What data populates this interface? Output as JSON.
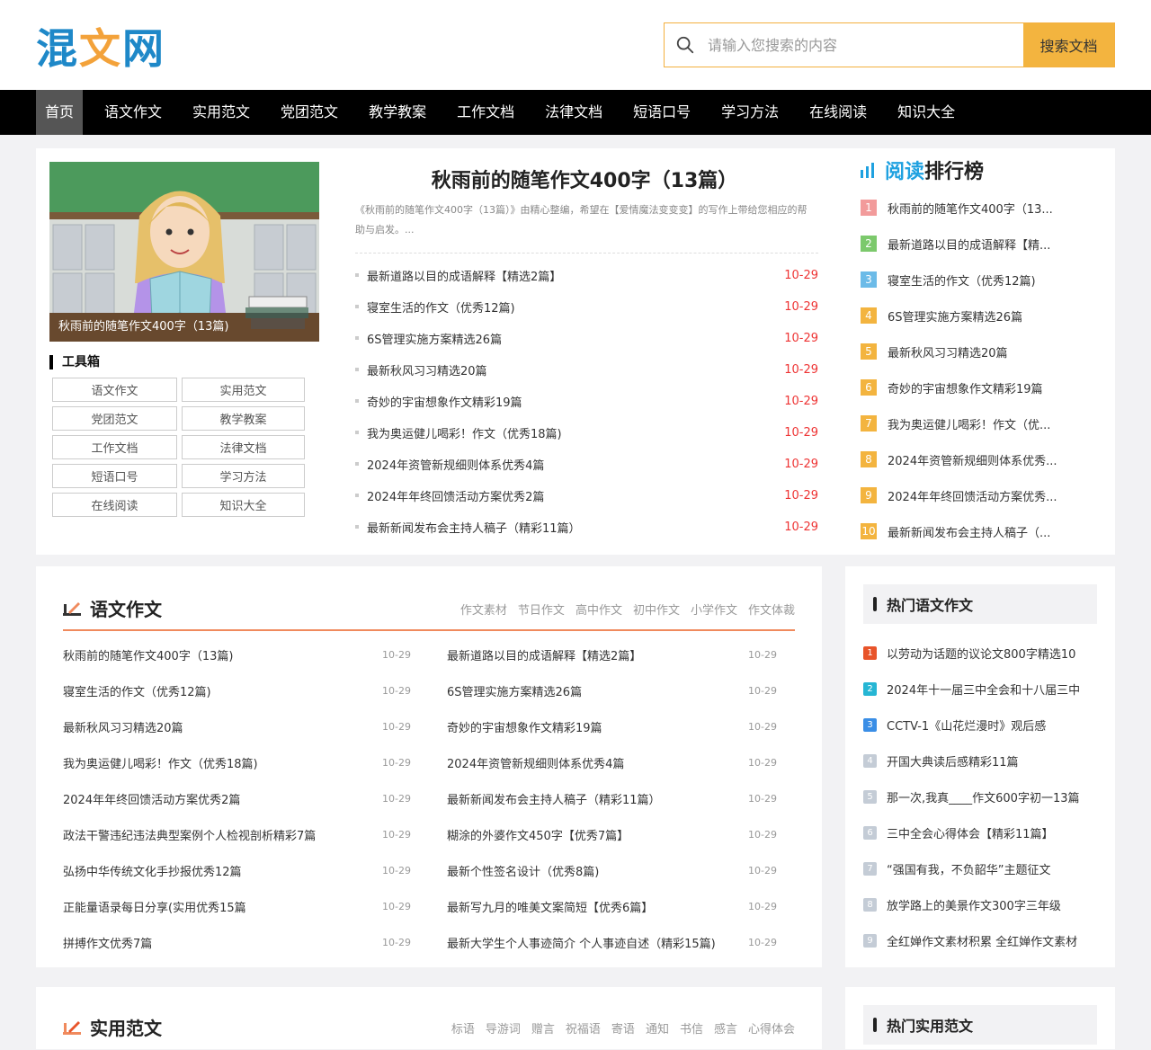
{
  "header": {
    "logo": [
      "混",
      "文",
      "网"
    ],
    "search": {
      "placeholder": "请输入您搜索的内容",
      "button": "搜索文档"
    }
  },
  "nav": [
    "首页",
    "语文作文",
    "实用范文",
    "党团范文",
    "教学教案",
    "工作文档",
    "法律文档",
    "短语口号",
    "学习方法",
    "在线阅读",
    "知识大全"
  ],
  "banner": {
    "caption": "秋雨前的随笔作文400字（13篇)"
  },
  "toolbox": {
    "title": "工具箱",
    "items": [
      "语文作文",
      "实用范文",
      "党团范文",
      "教学教案",
      "工作文档",
      "法律文档",
      "短语口号",
      "学习方法",
      "在线阅读",
      "知识大全"
    ]
  },
  "feature": {
    "title": "秋雨前的随笔作文400字（13篇）",
    "desc": "《秋雨前的随笔作文400字（13篇）》由精心整编，希望在【爱情魔法变变变】的写作上带给您相应的帮助与启发。...",
    "items": [
      {
        "title": "最新道路以目的成语解释【精选2篇】",
        "date": "10-29"
      },
      {
        "title": "寝室生活的作文（优秀12篇)",
        "date": "10-29"
      },
      {
        "title": "6S管理实施方案精选26篇",
        "date": "10-29"
      },
      {
        "title": "最新秋风习习精选20篇",
        "date": "10-29"
      },
      {
        "title": "奇妙的宇宙想象作文精彩19篇",
        "date": "10-29"
      },
      {
        "title": "我为奥运健儿喝彩！作文（优秀18篇)",
        "date": "10-29"
      },
      {
        "title": "2024年资管新规细则体系优秀4篇",
        "date": "10-29"
      },
      {
        "title": "2024年年终回馈活动方案优秀2篇",
        "date": "10-29"
      },
      {
        "title": "最新新闻发布会主持人稿子（精彩11篇）",
        "date": "10-29"
      }
    ]
  },
  "rank": {
    "title_hl": "阅读",
    "title_rest": "排行榜",
    "items": [
      {
        "num": "1",
        "title": "秋雨前的随笔作文400字（13...",
        "color": "#f29b9b"
      },
      {
        "num": "2",
        "title": "最新道路以目的成语解释【精...",
        "color": "#7cc96c"
      },
      {
        "num": "3",
        "title": "寝室生活的作文（优秀12篇)",
        "color": "#6cbbe8"
      },
      {
        "num": "4",
        "title": "6S管理实施方案精选26篇",
        "color": "#f3b43f"
      },
      {
        "num": "5",
        "title": "最新秋风习习精选20篇",
        "color": "#f3b43f"
      },
      {
        "num": "6",
        "title": "奇妙的宇宙想象作文精彩19篇",
        "color": "#f3b43f"
      },
      {
        "num": "7",
        "title": "我为奥运健儿喝彩！作文（优...",
        "color": "#f3b43f"
      },
      {
        "num": "8",
        "title": "2024年资管新规细则体系优秀...",
        "color": "#f3b43f"
      },
      {
        "num": "9",
        "title": "2024年年终回馈活动方案优秀...",
        "color": "#f3b43f"
      },
      {
        "num": "10",
        "title": "最新新闻发布会主持人稿子（...",
        "color": "#f3b43f"
      }
    ]
  },
  "yuwen": {
    "title": "语文作文",
    "tags": [
      "作文素材",
      "节日作文",
      "高中作文",
      "初中作文",
      "小学作文",
      "作文体裁"
    ],
    "left": [
      {
        "title": "秋雨前的随笔作文400字（13篇)",
        "date": "10-29"
      },
      {
        "title": "寝室生活的作文（优秀12篇)",
        "date": "10-29"
      },
      {
        "title": "最新秋风习习精选20篇",
        "date": "10-29"
      },
      {
        "title": "我为奥运健儿喝彩！作文（优秀18篇)",
        "date": "10-29"
      },
      {
        "title": "2024年年终回馈活动方案优秀2篇",
        "date": "10-29"
      },
      {
        "title": "政法干警违纪违法典型案例个人检视剖析精彩7篇",
        "date": "10-29"
      },
      {
        "title": "弘扬中华传统文化手抄报优秀12篇",
        "date": "10-29"
      },
      {
        "title": "正能量语录每日分享(实用优秀15篇",
        "date": "10-29"
      },
      {
        "title": "拼搏作文优秀7篇",
        "date": "10-29"
      }
    ],
    "right": [
      {
        "title": "最新道路以目的成语解释【精选2篇】",
        "date": "10-29"
      },
      {
        "title": "6S管理实施方案精选26篇",
        "date": "10-29"
      },
      {
        "title": "奇妙的宇宙想象作文精彩19篇",
        "date": "10-29"
      },
      {
        "title": "2024年资管新规细则体系优秀4篇",
        "date": "10-29"
      },
      {
        "title": "最新新闻发布会主持人稿子（精彩11篇）",
        "date": "10-29"
      },
      {
        "title": "糊涂的外婆作文450字【优秀7篇】",
        "date": "10-29"
      },
      {
        "title": "最新个性签名设计（优秀8篇)",
        "date": "10-29"
      },
      {
        "title": "最新写九月的唯美文案简短【优秀6篇】",
        "date": "10-29"
      },
      {
        "title": "最新大学生个人事迹简介 个人事迹自述（精彩15篇)",
        "date": "10-29"
      }
    ]
  },
  "hot_yuwen": {
    "title": "热门语文作文",
    "items": [
      {
        "num": "1",
        "title": "以劳动为话题的议论文800字精选10",
        "color": "#e8542a"
      },
      {
        "num": "2",
        "title": "2024年十一届三中全会和十八届三中",
        "color": "#26b6d4"
      },
      {
        "num": "3",
        "title": "CCTV-1《山花烂漫时》观后感",
        "color": "#3a8ee6"
      },
      {
        "num": "4",
        "title": "开国大典读后感精彩11篇",
        "color": "#c4ccd6"
      },
      {
        "num": "5",
        "title": "那一次,我真____作文600字初一13篇",
        "color": "#c4ccd6"
      },
      {
        "num": "6",
        "title": "三中全会心得体会【精彩11篇】",
        "color": "#c4ccd6"
      },
      {
        "num": "7",
        "title": "“强国有我，不负韶华”主题征文",
        "color": "#c4ccd6"
      },
      {
        "num": "8",
        "title": "放学路上的美景作文300字三年级",
        "color": "#c4ccd6"
      },
      {
        "num": "9",
        "title": "全红婵作文素材积累 全红婵作文素材",
        "color": "#c4ccd6"
      }
    ]
  },
  "shiyong": {
    "title": "实用范文",
    "tags": [
      "标语",
      "导游词",
      "赠言",
      "祝福语",
      "寄语",
      "通知",
      "书信",
      "感言",
      "心得体会"
    ]
  },
  "hot_shiyong": {
    "title": "热门实用范文"
  },
  "colors": {
    "accent": "#f3b43f",
    "brand_blue": "#1e88c8",
    "section_line": "#f08a5d"
  }
}
